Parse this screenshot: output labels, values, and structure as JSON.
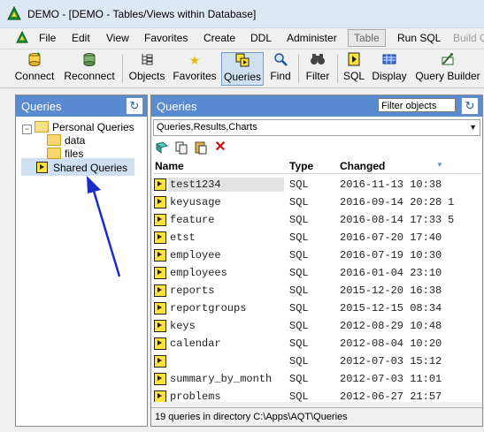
{
  "window": {
    "title": "DEMO - [DEMO - Tables/Views within Database]"
  },
  "menu": {
    "items": [
      "File",
      "Edit",
      "View",
      "Favorites",
      "Create",
      "DDL",
      "Administer",
      "Table",
      "Run SQL",
      "Build Q"
    ]
  },
  "toolbar": {
    "buttons": [
      {
        "label": "Connect",
        "icon": "database-plug-icon"
      },
      {
        "label": "Reconnect",
        "icon": "database-refresh-icon"
      },
      {
        "label": "Objects",
        "icon": "tree-icon"
      },
      {
        "label": "Favorites",
        "icon": "star-icon"
      },
      {
        "label": "Queries",
        "icon": "query-icon"
      },
      {
        "label": "Find",
        "icon": "magnifier-icon"
      },
      {
        "label": "Filter",
        "icon": "binoculars-icon"
      },
      {
        "label": "SQL",
        "icon": "sql-icon"
      },
      {
        "label": "Display",
        "icon": "grid-icon"
      },
      {
        "label": "Query Builder",
        "icon": "builder-icon"
      }
    ]
  },
  "left_panel": {
    "title": "Queries",
    "tree": {
      "root": "Personal Queries",
      "children": [
        "data",
        "files"
      ],
      "shared": "Shared Queries"
    }
  },
  "right_panel": {
    "title": "Queries",
    "filter_placeholder": "Filter objects",
    "view_select": "Queries,Results,Charts",
    "columns": {
      "name": "Name",
      "type": "Type",
      "changed": "Changed"
    },
    "rows": [
      {
        "name": "test1234",
        "type": "SQL",
        "changed": "2016-11-13 10:38",
        "extra": ""
      },
      {
        "name": "keyusage",
        "type": "SQL",
        "changed": "2016-09-14 20:28",
        "extra": "1"
      },
      {
        "name": "feature",
        "type": "SQL",
        "changed": "2016-08-14 17:33",
        "extra": "5"
      },
      {
        "name": "etst",
        "type": "SQL",
        "changed": "2016-07-20 17:40",
        "extra": ""
      },
      {
        "name": "employee",
        "type": "SQL",
        "changed": "2016-07-19 10:30",
        "extra": ""
      },
      {
        "name": "employees",
        "type": "SQL",
        "changed": "2016-01-04 23:10",
        "extra": ""
      },
      {
        "name": "reports",
        "type": "SQL",
        "changed": "2015-12-20 16:38",
        "extra": ""
      },
      {
        "name": "reportgroups",
        "type": "SQL",
        "changed": "2015-12-15 08:34",
        "extra": ""
      },
      {
        "name": "keys",
        "type": "SQL",
        "changed": "2012-08-29 10:48",
        "extra": ""
      },
      {
        "name": "calendar",
        "type": "SQL",
        "changed": "2012-08-04 10:20",
        "extra": ""
      },
      {
        "name": "",
        "type": "SQL",
        "changed": "2012-07-03 15:12",
        "extra": ""
      },
      {
        "name": "summary_by_month",
        "type": "SQL",
        "changed": "2012-07-03 11:01",
        "extra": ""
      },
      {
        "name": "problems",
        "type": "SQL",
        "changed": "2012-06-27 21:57",
        "extra": ""
      }
    ],
    "status": "19 queries in directory C:\\Apps\\AQT\\Queries"
  },
  "colors": {
    "panel_header": "#5a8bd0",
    "selection": "#cfe0f2",
    "arrow": "#1a2ccc"
  }
}
